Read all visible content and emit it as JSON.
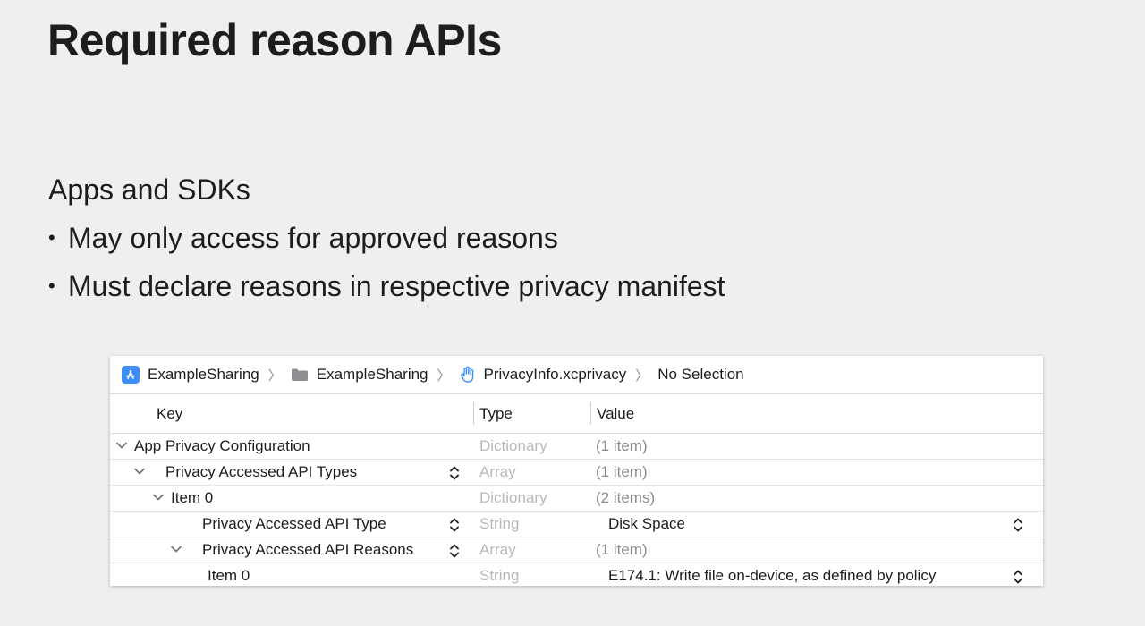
{
  "slide": {
    "title": "Required reason APIs",
    "subheading": "Apps and SDKs",
    "bullets": [
      "May only access for approved reasons",
      "Must declare reasons in respective privacy manifest"
    ]
  },
  "editor": {
    "jumpbar": [
      {
        "label": "ExampleSharing",
        "icon": "app-store-icon"
      },
      {
        "label": "ExampleSharing",
        "icon": "folder-icon"
      },
      {
        "label": "PrivacyInfo.xcprivacy",
        "icon": "hand-icon"
      },
      {
        "label": "No Selection",
        "icon": ""
      }
    ],
    "columns": {
      "key": "Key",
      "type": "Type",
      "value": "Value"
    },
    "rows": [
      {
        "key": "App Privacy Configuration",
        "type": "Dictionary",
        "value": "(1 item)"
      },
      {
        "key": "Privacy Accessed API Types",
        "type": "Array",
        "value": "(1 item)"
      },
      {
        "key": "Item 0",
        "type": "Dictionary",
        "value": "(2 items)"
      },
      {
        "key": "Privacy Accessed API Type",
        "type": "String",
        "value": "Disk Space"
      },
      {
        "key": "Privacy Accessed API Reasons",
        "type": "Array",
        "value": "(1 item)"
      },
      {
        "key": "Item 0",
        "type": "String",
        "value": "E174.1: Write file on-device, as defined by policy"
      }
    ]
  }
}
